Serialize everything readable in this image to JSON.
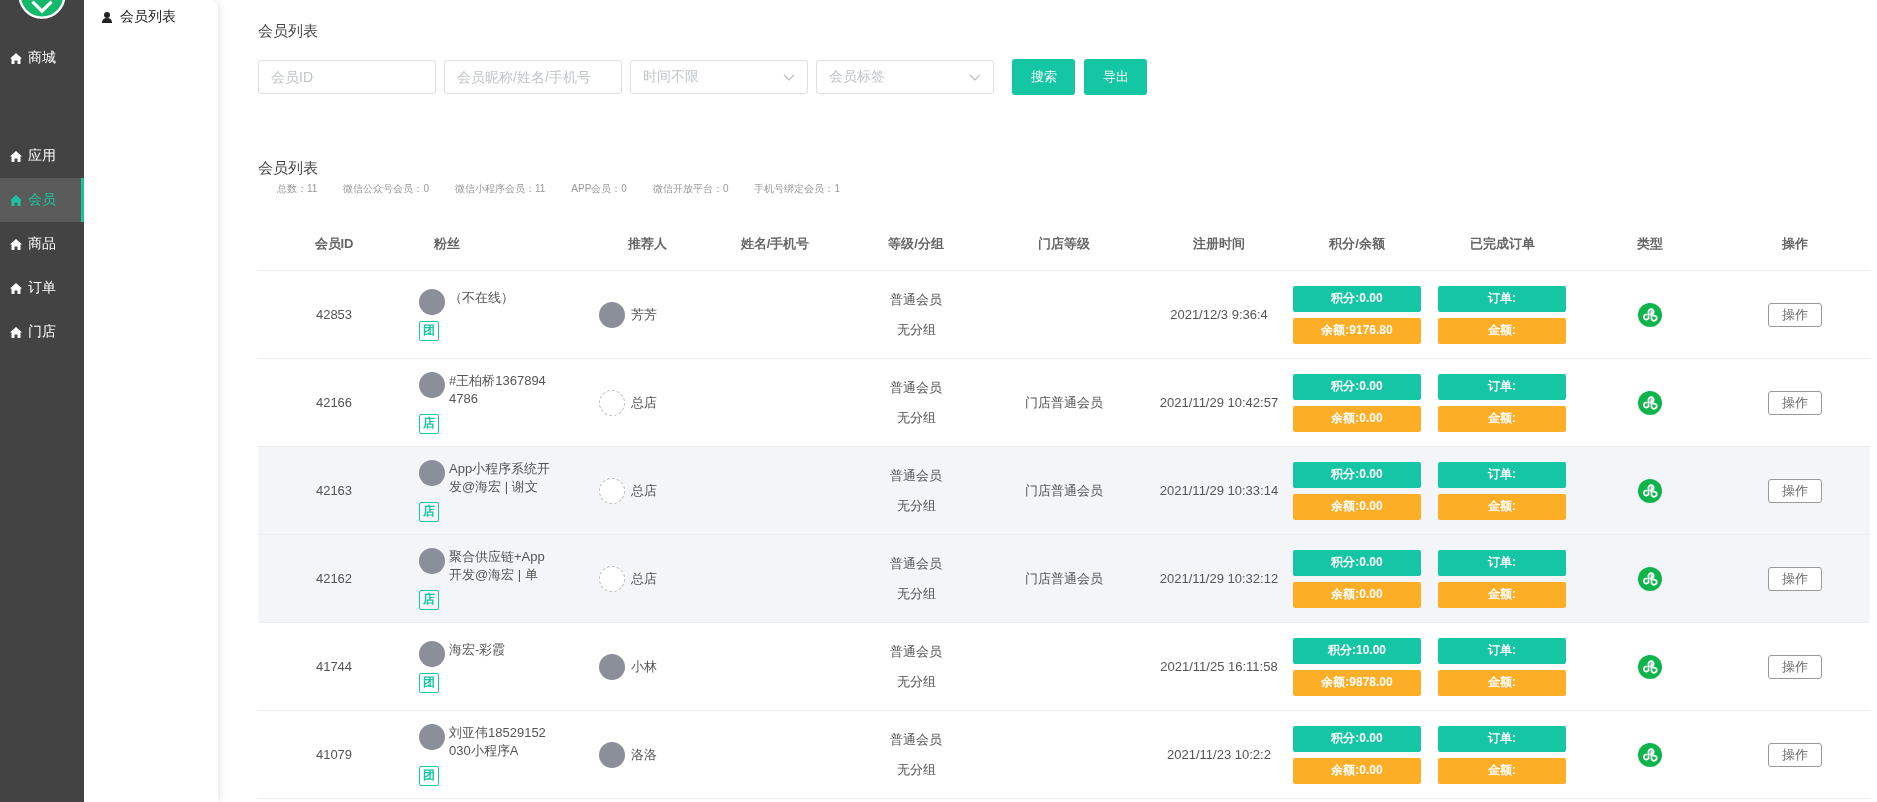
{
  "sidebar": {
    "items": [
      {
        "label": "商城",
        "selected": false
      },
      {
        "label": "应用",
        "selected": false
      },
      {
        "label": "会员",
        "selected": true
      },
      {
        "label": "商品",
        "selected": false
      },
      {
        "label": "订单",
        "selected": false
      },
      {
        "label": "门店",
        "selected": false
      }
    ]
  },
  "subnav": {
    "items": [
      {
        "label": "会员列表"
      }
    ]
  },
  "page_title": "会员列表",
  "filters": [
    {
      "kind": "input",
      "placeholder": "会员ID"
    },
    {
      "kind": "input",
      "placeholder": "会员昵称/姓名/手机号"
    },
    {
      "kind": "select",
      "placeholder": "时间不限"
    },
    {
      "kind": "select",
      "placeholder": "会员标签"
    }
  ],
  "buttons": [
    "搜索",
    "导出"
  ],
  "list_title": "会员列表",
  "stats": [
    "总数：11",
    "微信公众号会员：0",
    "微信小程序会员：11",
    "APP会员：0",
    "微信开放平台：0",
    "手机号绑定会员：1"
  ],
  "table": {
    "columns": [
      "会员ID",
      "粉丝",
      "推荐人",
      "姓名/手机号",
      "等级/分组",
      "门店等级",
      "注册时间",
      "积分/余额",
      "已完成订单",
      "类型",
      "操作"
    ],
    "rows": [
      {
        "id": "42853",
        "fan": {
          "name": "（不在线）",
          "tag": "团"
        },
        "referrer": {
          "name": "芳芳",
          "has_photo": true
        },
        "level": "普通会员",
        "group": "无分组",
        "registered": "2021/12/3 9:36:4",
        "points": "积分:0.00",
        "balance": "余额:9176.80",
        "orders": "订单:",
        "amount": "金额:",
        "action": "操作",
        "shaded": false
      },
      {
        "id": "42166",
        "fan": {
          "name": "#王柏桥13678944786",
          "tag": "店"
        },
        "referrer": {
          "name": "总店",
          "has_photo": false
        },
        "level": "普通会员",
        "group": "无分组",
        "store_level": "门店普通会员",
        "registered": "2021/11/29 10:42:57",
        "points": "积分:0.00",
        "balance": "余额:0.00",
        "orders": "订单:",
        "amount": "金额:",
        "action": "操作",
        "shaded": false
      },
      {
        "id": "42163",
        "fan": {
          "name": " App小程序系统开发@海宏 | 谢文",
          "tag": "店"
        },
        "referrer": {
          "name": "总店",
          "has_photo": false
        },
        "level": "普通会员",
        "group": "无分组",
        "store_level": "门店普通会员",
        "registered": "2021/11/29 10:33:14",
        "points": "积分:0.00",
        "balance": "余额:0.00",
        "orders": "订单:",
        "amount": "金额:",
        "action": "操作",
        "shaded": true
      },
      {
        "id": "42162",
        "fan": {
          "name": "聚合供应链+App开发@海宏 | 单",
          "tag": "店"
        },
        "referrer": {
          "name": "总店",
          "has_photo": false
        },
        "level": "普通会员",
        "group": "无分组",
        "store_level": "门店普通会员",
        "registered": "2021/11/29 10:32:12",
        "points": "积分:0.00",
        "balance": "余额:0.00",
        "orders": "订单:",
        "amount": "金额:",
        "action": "操作",
        "shaded": true
      },
      {
        "id": "41744",
        "fan": {
          "name": "海宏-彩霞",
          "tag": "团"
        },
        "referrer": {
          "name": "小林",
          "has_photo": true
        },
        "level": "普通会员",
        "group": "无分组",
        "registered": "2021/11/25 16:11:58",
        "points": "积分:10.00",
        "balance": "余额:9878.00",
        "orders": "订单:",
        "amount": "金额:",
        "action": "操作",
        "shaded": false
      },
      {
        "id": "41079",
        "fan": {
          "name": "刘亚伟18529152030小程序A",
          "tag": "团"
        },
        "referrer": {
          "name": "洛洛",
          "has_photo": true
        },
        "level": "普通会员",
        "group": "无分组",
        "registered": "2021/11/23 10:2:2",
        "points": "积分:0.00",
        "balance": "余额:0.00",
        "orders": "订单:",
        "amount": "金额:",
        "action": "操作",
        "shaded": false
      }
    ]
  }
}
